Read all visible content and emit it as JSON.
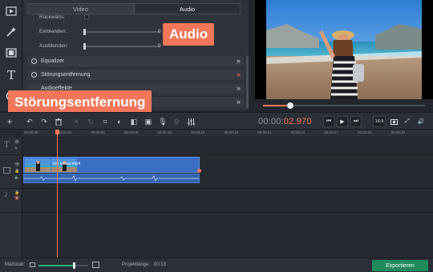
{
  "left_toolbar": {
    "tools": [
      {
        "icon": "import-media-icon"
      },
      {
        "icon": "magic-wand-icon"
      },
      {
        "icon": "filmstrip-icon"
      },
      {
        "icon": "text-icon"
      },
      {
        "icon": "clock-icon"
      },
      {
        "icon": "more-tools-icon"
      }
    ]
  },
  "panel": {
    "tabs": [
      {
        "label": "Video",
        "active": false
      },
      {
        "label": "Audio",
        "active": true
      }
    ],
    "rows": [
      {
        "label": "Rückwärts:"
      },
      {
        "label": "Einblenden:",
        "value": "0"
      },
      {
        "label": "Ausblenden:",
        "value": "0"
      }
    ],
    "sections": [
      {
        "label": "Equalizer"
      },
      {
        "label": "Störungsentfernung"
      },
      {
        "label": "Audioeffekte"
      },
      {
        "label": ""
      }
    ]
  },
  "callouts": {
    "audio": "Audio",
    "noise": "Störungsentfernung"
  },
  "player": {
    "time_main": "00:00:",
    "time_accent": "02.970",
    "aspect": "16:9",
    "seek_progress": 0.17
  },
  "ruler": {
    "ticks": [
      "00:00:00",
      "00:00:03",
      "00:00:06",
      "00:00:09",
      "00:00:12",
      "00:00:15",
      "00:00:18",
      "00:00:21",
      "00:00:24",
      "00:00:27",
      "00:00:30",
      "00:00:33"
    ]
  },
  "timeline": {
    "clip_name": "my video.mp4",
    "playhead_time_s": 2.97
  },
  "status": {
    "scale_label": "Maßstab:",
    "length_label": "Projektlänge:",
    "length_value": "00:13",
    "export_label": "Exportieren"
  },
  "colors": {
    "accent": "#f2765a",
    "clip": "#3a6fc4",
    "export": "#1f8a5c"
  }
}
